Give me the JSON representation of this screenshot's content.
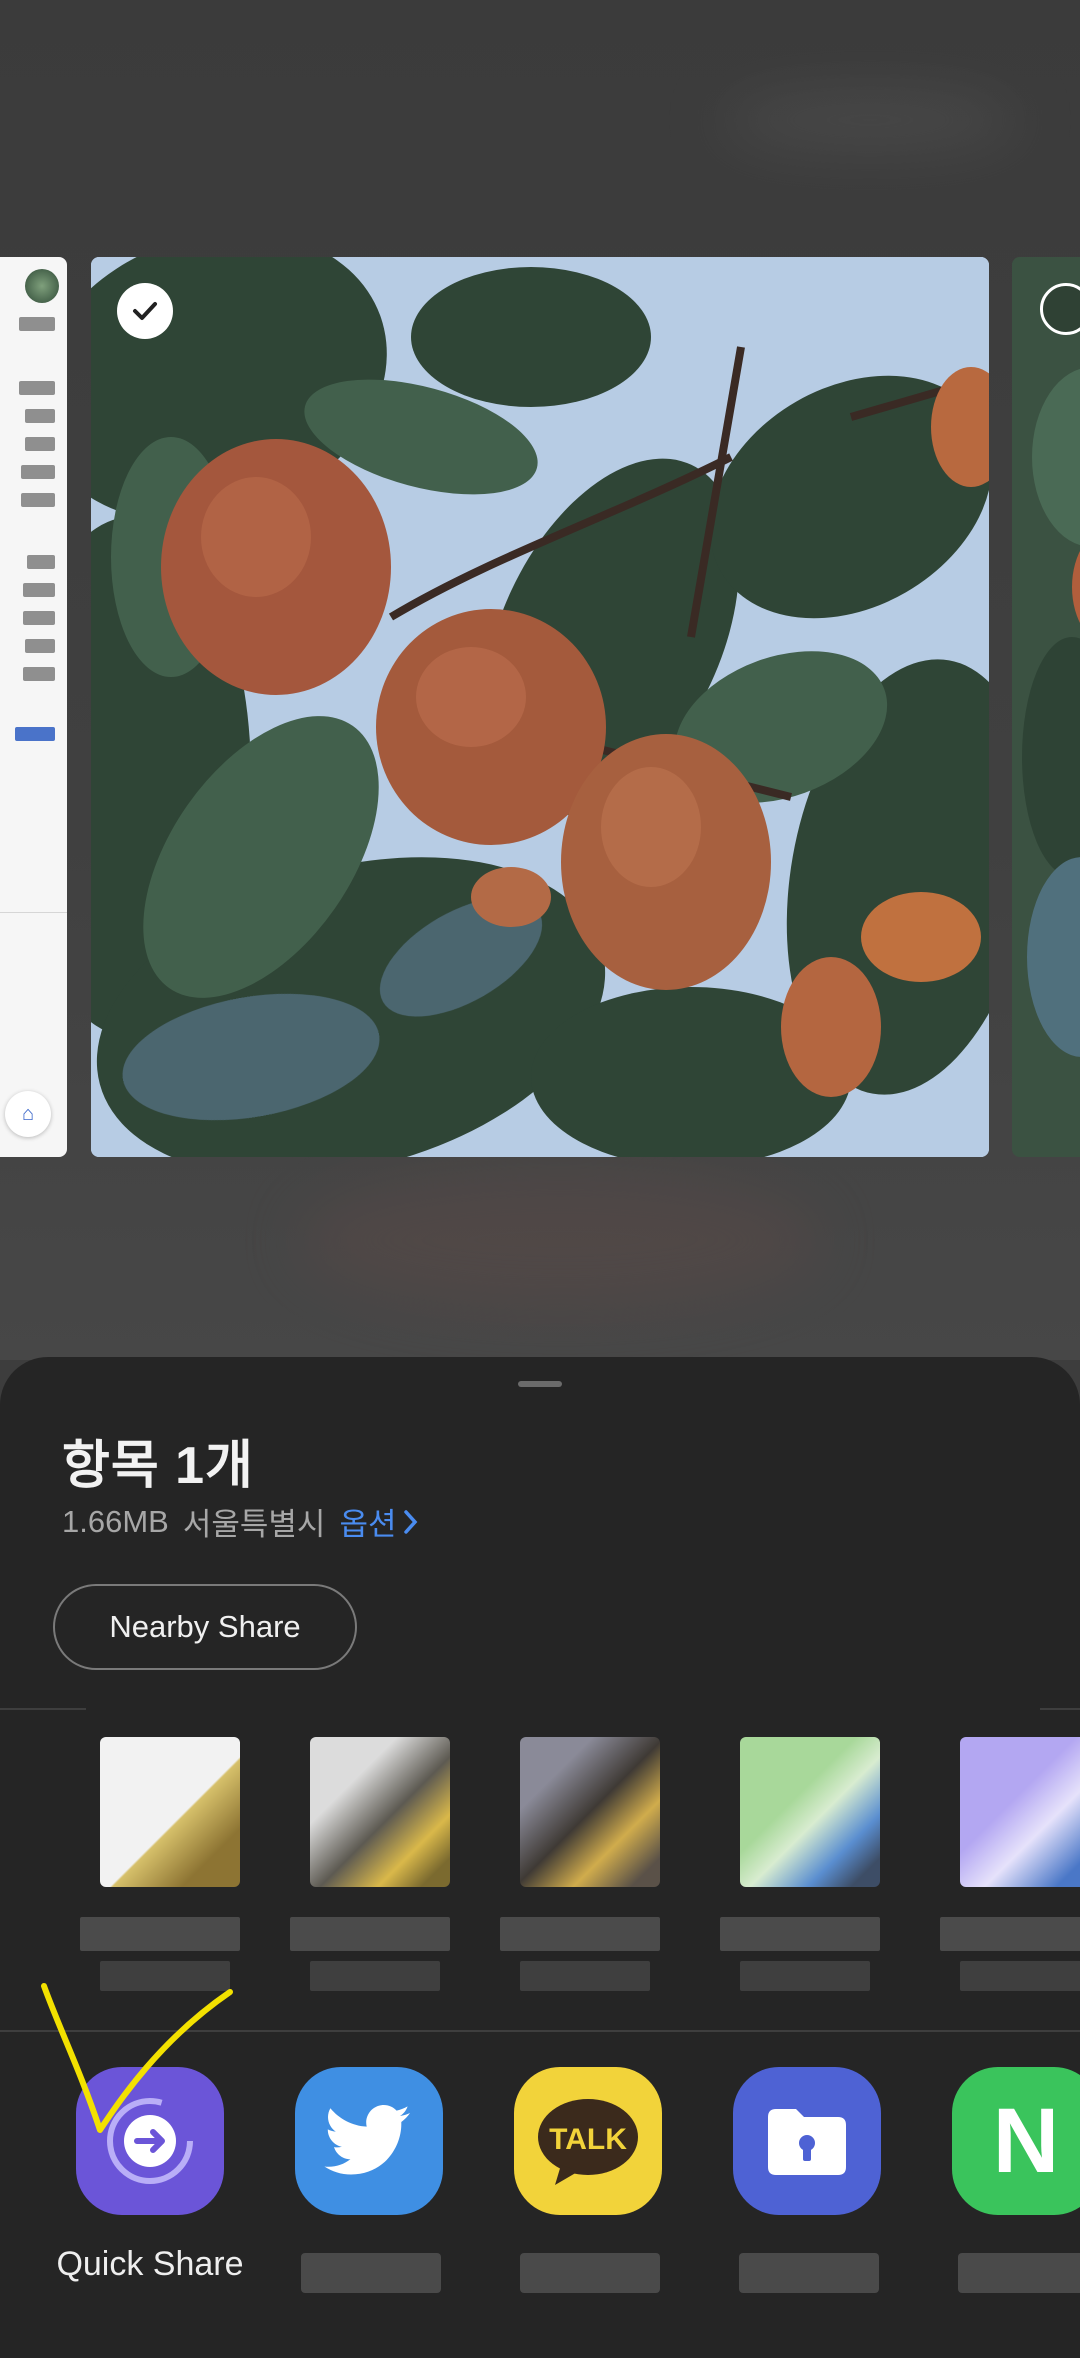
{
  "sheet": {
    "title": "항목 1개",
    "file_size": "1.66MB",
    "location": "서울특별시",
    "options_label": "옵션",
    "nearby_share_label": "Nearby Share"
  },
  "apps": [
    {
      "label": "Quick Share",
      "icon": "quick-share-icon",
      "color": "#6b55d8"
    },
    {
      "label": "",
      "icon": "twitter-icon",
      "color": "#3f8fe3"
    },
    {
      "label": "",
      "icon": "kakaotalk-icon",
      "color": "#f2d33a"
    },
    {
      "label": "",
      "icon": "secure-folder-icon",
      "color": "#4e62d4"
    },
    {
      "label": "",
      "icon": "naver-icon",
      "color": "#3ac45c"
    }
  ],
  "kakao_icon_text": "TALK",
  "naver_icon_text": "N",
  "colors": {
    "sheet_bg": "#252525",
    "accent_link": "#4a8cf0",
    "annotation": "#f3e100"
  }
}
